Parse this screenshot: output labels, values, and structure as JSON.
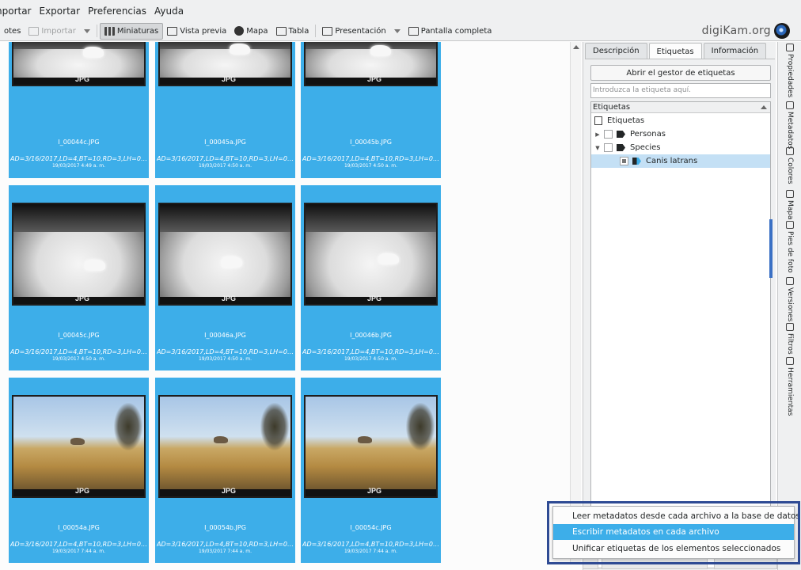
{
  "menubar": {
    "items": [
      "nportar",
      "Exportar",
      "Preferencias",
      "Ayuda"
    ]
  },
  "toolbar": {
    "items": [
      {
        "label": "otes",
        "icon": "albums-icon"
      },
      {
        "label": "Importar",
        "icon": "import-icon",
        "disabled": true
      },
      {
        "label": "Miniaturas",
        "icon": "thumbnails-icon",
        "active": true
      },
      {
        "label": "Vista previa",
        "icon": "preview-icon"
      },
      {
        "label": "Mapa",
        "icon": "globe-icon"
      },
      {
        "label": "Tabla",
        "icon": "table-icon"
      },
      {
        "label": "Presentación",
        "icon": "slideshow-icon"
      },
      {
        "label": "Pantalla completa",
        "icon": "fullscreen-icon"
      }
    ],
    "brand": "digiKam.org"
  },
  "thumbnails": [
    {
      "name": "I_00044c.JPG",
      "meta": "AD=3/16/2017,LD=4,BT=10,RD=3,LH=0,...",
      "date": "19/03/2017 4:49 a. m.",
      "scene": "night"
    },
    {
      "name": "I_00045a.JPG",
      "meta": "AD=3/16/2017,LD=4,BT=10,RD=3,LH=0,...",
      "date": "19/03/2017 4:50 a. m.",
      "scene": "night"
    },
    {
      "name": "I_00045b.JPG",
      "meta": "AD=3/16/2017,LD=4,BT=10,RD=3,LH=0,...",
      "date": "19/03/2017 4:50 a. m.",
      "scene": "night"
    },
    {
      "name": "I_00045c.JPG",
      "meta": "AD=3/16/2017,LD=4,BT=10,RD=3,LH=0,...",
      "date": "19/03/2017 4:50 a. m.",
      "scene": "night"
    },
    {
      "name": "I_00046a.JPG",
      "meta": "AD=3/16/2017,LD=4,BT=10,RD=3,LH=0,...",
      "date": "19/03/2017 4:50 a. m.",
      "scene": "night"
    },
    {
      "name": "I_00046b.JPG",
      "meta": "AD=3/16/2017,LD=4,BT=10,RD=3,LH=0,...",
      "date": "19/03/2017 4:50 a. m.",
      "scene": "night"
    },
    {
      "name": "I_00054a.JPG",
      "meta": "AD=3/16/2017,LD=4,BT=10,RD=3,LH=0,...",
      "date": "19/03/2017 7:44 a. m.",
      "scene": "day"
    },
    {
      "name": "I_00054b.JPG",
      "meta": "AD=3/16/2017,LD=4,BT=10,RD=3,LH=0,...",
      "date": "19/03/2017 7:44 a. m.",
      "scene": "day"
    },
    {
      "name": "I_00054c.JPG",
      "meta": "AD=3/16/2017,LD=4,BT=10,RD=3,LH=0,...",
      "date": "19/03/2017 7:44 a. m.",
      "scene": "day"
    }
  ],
  "image_overlay_text": "JPG",
  "right_panel": {
    "tabs": [
      "Descripción",
      "Etiquetas",
      "Información"
    ],
    "active_tab": "Etiquetas",
    "open_manager_label": "Abrir el gestor de etiquetas",
    "tag_input_placeholder": "Introduzca la etiqueta aquí.",
    "tree_header": "Etiquetas",
    "tree": [
      {
        "label": "Etiquetas",
        "level": 0,
        "icon": "tag-root-icon"
      },
      {
        "label": "Personas",
        "level": 1,
        "expander": "collapsed",
        "checked": "none"
      },
      {
        "label": "Species",
        "level": 1,
        "expander": "expanded",
        "checked": "none"
      },
      {
        "label": "Canis latrans",
        "level": 2,
        "checked": "partial",
        "selected": true
      }
    ]
  },
  "side_tabs": [
    {
      "label": "Propiedades",
      "icon": "properties-icon"
    },
    {
      "label": "Metadatos",
      "icon": "metadata-icon"
    },
    {
      "label": "Colores",
      "icon": "colors-icon"
    },
    {
      "label": "Mapa",
      "icon": "map-icon"
    },
    {
      "label": "Pies de foto",
      "icon": "captions-icon",
      "active": true
    },
    {
      "label": "Versiones",
      "icon": "versions-icon"
    },
    {
      "label": "Filtros",
      "icon": "filters-icon"
    },
    {
      "label": "Herramientas",
      "icon": "tools-icon"
    }
  ],
  "popup_menu": {
    "items": [
      {
        "label": "Leer metadatos desde cada archivo a la base de datos",
        "highlighted": false
      },
      {
        "label": "Escribir metadatos en cada archivo",
        "highlighted": true
      },
      {
        "label": "Unificar etiquetas de los elementos seleccionados",
        "highlighted": false
      }
    ]
  },
  "colors": {
    "selection": "#3daee9",
    "popup_frame": "#2f4b94",
    "side_active": "#3b70c4"
  }
}
